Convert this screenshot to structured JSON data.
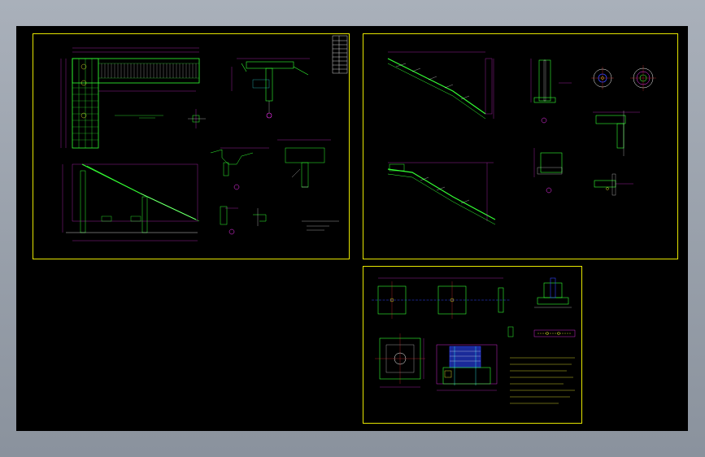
{
  "window": {
    "background": "#000000",
    "frame_color": "#e6e600"
  },
  "colors": {
    "green": "#33ff33",
    "magenta": "#ff33ff",
    "cyan": "#33ffff",
    "yellow": "#ffff33",
    "white": "#ffffff",
    "red": "#ff3333",
    "blue": "#3344ff"
  },
  "sheets": [
    {
      "id": "sheet-1",
      "title": ""
    },
    {
      "id": "sheet-2",
      "title": ""
    },
    {
      "id": "sheet-3",
      "title": ""
    }
  ]
}
